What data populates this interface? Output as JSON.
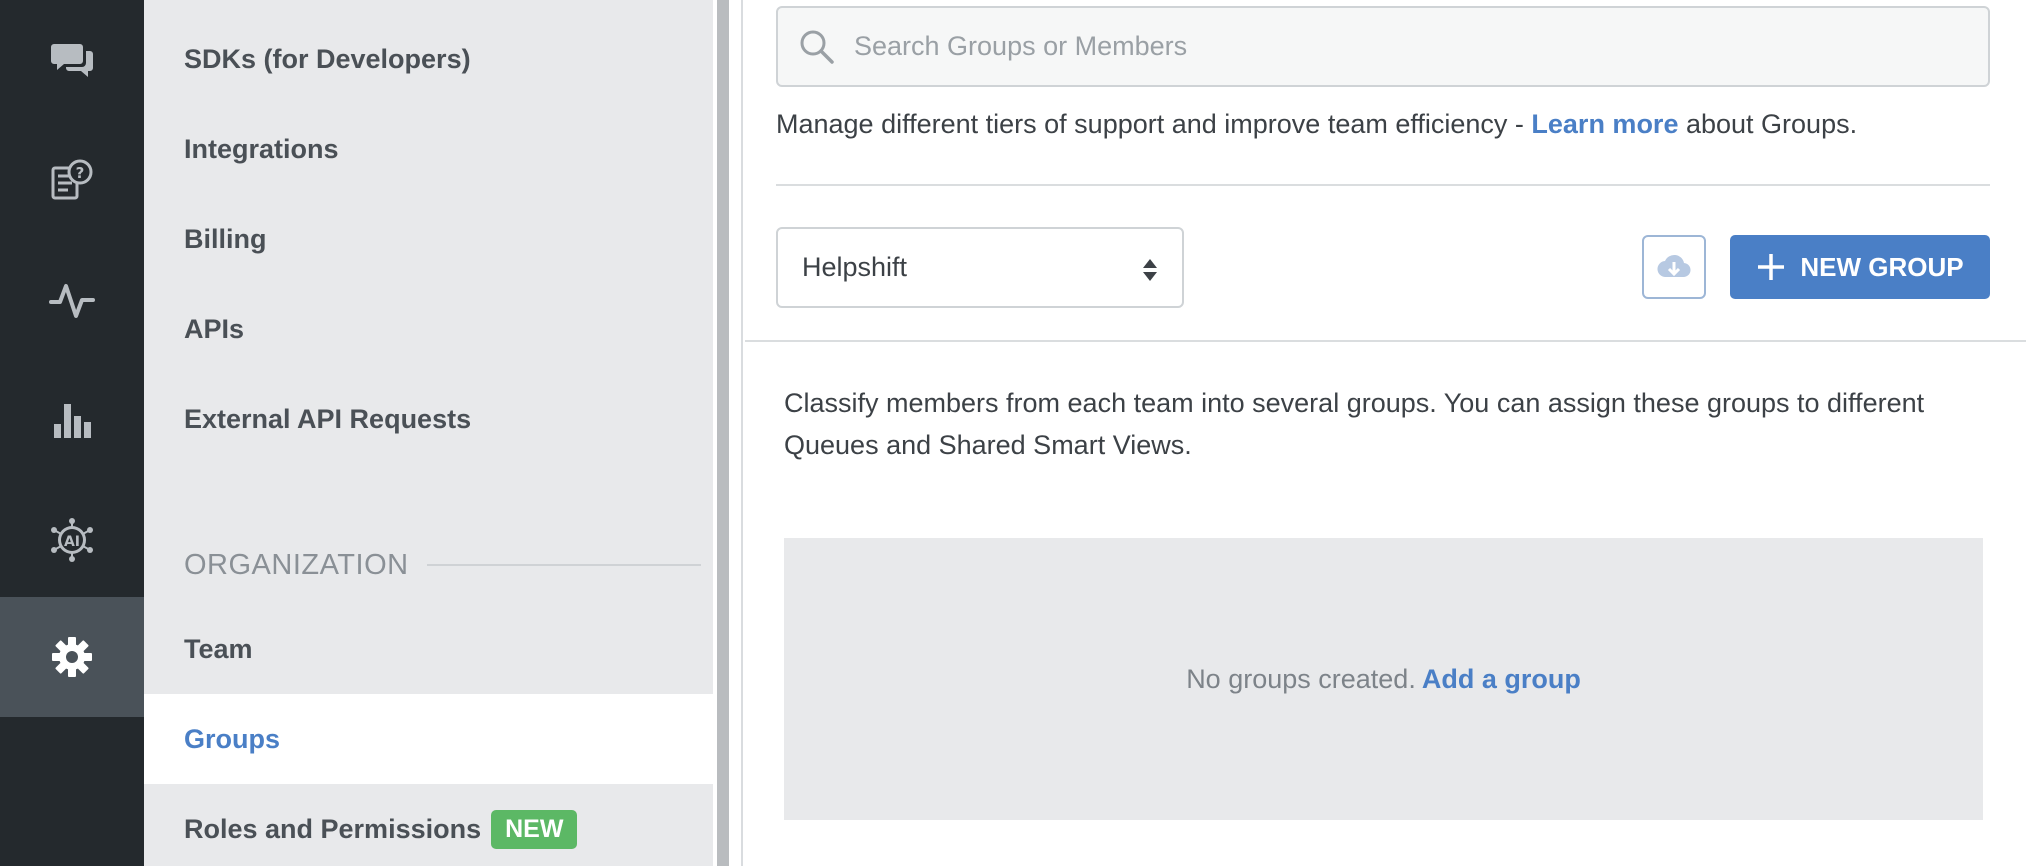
{
  "rail": {
    "items": [
      {
        "icon": "chat-bubbles-icon"
      },
      {
        "icon": "faq-icon"
      },
      {
        "icon": "activity-icon"
      },
      {
        "icon": "analytics-icon"
      },
      {
        "icon": "ai-icon",
        "label": "AI"
      },
      {
        "icon": "gear-icon"
      }
    ],
    "active_index": 5
  },
  "nav": {
    "items": [
      {
        "label": "SDKs (for Developers)"
      },
      {
        "label": "Integrations"
      },
      {
        "label": "Billing"
      },
      {
        "label": "APIs"
      },
      {
        "label": "External API Requests"
      }
    ],
    "section_label": "ORGANIZATION",
    "org_items": [
      {
        "label": "Team"
      },
      {
        "label": "Groups"
      },
      {
        "label": "Roles and Permissions",
        "badge": "NEW"
      }
    ],
    "active": "Groups"
  },
  "main": {
    "search": {
      "placeholder": "Search Groups or Members",
      "value": ""
    },
    "intro": {
      "prefix": "Manage different tiers of support and improve team efficiency - ",
      "link": "Learn more",
      "suffix": " about Groups."
    },
    "team_select": {
      "value": "Helpshift"
    },
    "new_group_label": "NEW GROUP",
    "description": "Classify members from each team into several groups. You can assign these groups to different Queues and Shared Smart Views.",
    "empty_state": {
      "text": "No groups created.",
      "link": "Add a group"
    }
  },
  "colors": {
    "rail_bg": "#24292d",
    "rail_active": "#4a5259",
    "nav_bg": "#e8e9eb",
    "accent": "#4a7fc6",
    "badge_green": "#5cb865"
  }
}
